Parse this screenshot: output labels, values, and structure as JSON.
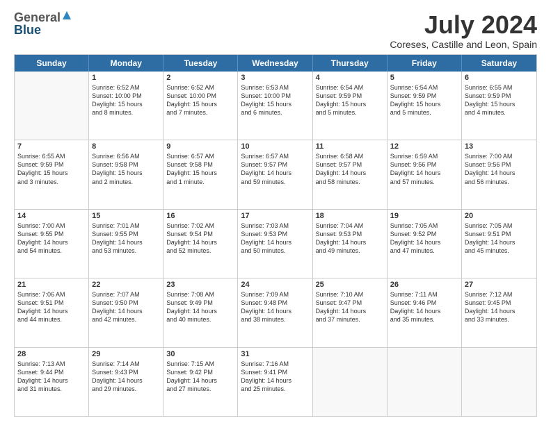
{
  "logo": {
    "general": "General",
    "blue": "Blue"
  },
  "title": "July 2024",
  "subtitle": "Coreses, Castille and Leon, Spain",
  "days": [
    "Sunday",
    "Monday",
    "Tuesday",
    "Wednesday",
    "Thursday",
    "Friday",
    "Saturday"
  ],
  "weeks": [
    [
      {
        "day": "",
        "lines": []
      },
      {
        "day": "1",
        "lines": [
          "Sunrise: 6:52 AM",
          "Sunset: 10:00 PM",
          "Daylight: 15 hours",
          "and 8 minutes."
        ]
      },
      {
        "day": "2",
        "lines": [
          "Sunrise: 6:52 AM",
          "Sunset: 10:00 PM",
          "Daylight: 15 hours",
          "and 7 minutes."
        ]
      },
      {
        "day": "3",
        "lines": [
          "Sunrise: 6:53 AM",
          "Sunset: 10:00 PM",
          "Daylight: 15 hours",
          "and 6 minutes."
        ]
      },
      {
        "day": "4",
        "lines": [
          "Sunrise: 6:54 AM",
          "Sunset: 9:59 PM",
          "Daylight: 15 hours",
          "and 5 minutes."
        ]
      },
      {
        "day": "5",
        "lines": [
          "Sunrise: 6:54 AM",
          "Sunset: 9:59 PM",
          "Daylight: 15 hours",
          "and 5 minutes."
        ]
      },
      {
        "day": "6",
        "lines": [
          "Sunrise: 6:55 AM",
          "Sunset: 9:59 PM",
          "Daylight: 15 hours",
          "and 4 minutes."
        ]
      }
    ],
    [
      {
        "day": "7",
        "lines": [
          "Sunrise: 6:55 AM",
          "Sunset: 9:59 PM",
          "Daylight: 15 hours",
          "and 3 minutes."
        ]
      },
      {
        "day": "8",
        "lines": [
          "Sunrise: 6:56 AM",
          "Sunset: 9:58 PM",
          "Daylight: 15 hours",
          "and 2 minutes."
        ]
      },
      {
        "day": "9",
        "lines": [
          "Sunrise: 6:57 AM",
          "Sunset: 9:58 PM",
          "Daylight: 15 hours",
          "and 1 minute."
        ]
      },
      {
        "day": "10",
        "lines": [
          "Sunrise: 6:57 AM",
          "Sunset: 9:57 PM",
          "Daylight: 14 hours",
          "and 59 minutes."
        ]
      },
      {
        "day": "11",
        "lines": [
          "Sunrise: 6:58 AM",
          "Sunset: 9:57 PM",
          "Daylight: 14 hours",
          "and 58 minutes."
        ]
      },
      {
        "day": "12",
        "lines": [
          "Sunrise: 6:59 AM",
          "Sunset: 9:56 PM",
          "Daylight: 14 hours",
          "and 57 minutes."
        ]
      },
      {
        "day": "13",
        "lines": [
          "Sunrise: 7:00 AM",
          "Sunset: 9:56 PM",
          "Daylight: 14 hours",
          "and 56 minutes."
        ]
      }
    ],
    [
      {
        "day": "14",
        "lines": [
          "Sunrise: 7:00 AM",
          "Sunset: 9:55 PM",
          "Daylight: 14 hours",
          "and 54 minutes."
        ]
      },
      {
        "day": "15",
        "lines": [
          "Sunrise: 7:01 AM",
          "Sunset: 9:55 PM",
          "Daylight: 14 hours",
          "and 53 minutes."
        ]
      },
      {
        "day": "16",
        "lines": [
          "Sunrise: 7:02 AM",
          "Sunset: 9:54 PM",
          "Daylight: 14 hours",
          "and 52 minutes."
        ]
      },
      {
        "day": "17",
        "lines": [
          "Sunrise: 7:03 AM",
          "Sunset: 9:53 PM",
          "Daylight: 14 hours",
          "and 50 minutes."
        ]
      },
      {
        "day": "18",
        "lines": [
          "Sunrise: 7:04 AM",
          "Sunset: 9:53 PM",
          "Daylight: 14 hours",
          "and 49 minutes."
        ]
      },
      {
        "day": "19",
        "lines": [
          "Sunrise: 7:05 AM",
          "Sunset: 9:52 PM",
          "Daylight: 14 hours",
          "and 47 minutes."
        ]
      },
      {
        "day": "20",
        "lines": [
          "Sunrise: 7:05 AM",
          "Sunset: 9:51 PM",
          "Daylight: 14 hours",
          "and 45 minutes."
        ]
      }
    ],
    [
      {
        "day": "21",
        "lines": [
          "Sunrise: 7:06 AM",
          "Sunset: 9:51 PM",
          "Daylight: 14 hours",
          "and 44 minutes."
        ]
      },
      {
        "day": "22",
        "lines": [
          "Sunrise: 7:07 AM",
          "Sunset: 9:50 PM",
          "Daylight: 14 hours",
          "and 42 minutes."
        ]
      },
      {
        "day": "23",
        "lines": [
          "Sunrise: 7:08 AM",
          "Sunset: 9:49 PM",
          "Daylight: 14 hours",
          "and 40 minutes."
        ]
      },
      {
        "day": "24",
        "lines": [
          "Sunrise: 7:09 AM",
          "Sunset: 9:48 PM",
          "Daylight: 14 hours",
          "and 38 minutes."
        ]
      },
      {
        "day": "25",
        "lines": [
          "Sunrise: 7:10 AM",
          "Sunset: 9:47 PM",
          "Daylight: 14 hours",
          "and 37 minutes."
        ]
      },
      {
        "day": "26",
        "lines": [
          "Sunrise: 7:11 AM",
          "Sunset: 9:46 PM",
          "Daylight: 14 hours",
          "and 35 minutes."
        ]
      },
      {
        "day": "27",
        "lines": [
          "Sunrise: 7:12 AM",
          "Sunset: 9:45 PM",
          "Daylight: 14 hours",
          "and 33 minutes."
        ]
      }
    ],
    [
      {
        "day": "28",
        "lines": [
          "Sunrise: 7:13 AM",
          "Sunset: 9:44 PM",
          "Daylight: 14 hours",
          "and 31 minutes."
        ]
      },
      {
        "day": "29",
        "lines": [
          "Sunrise: 7:14 AM",
          "Sunset: 9:43 PM",
          "Daylight: 14 hours",
          "and 29 minutes."
        ]
      },
      {
        "day": "30",
        "lines": [
          "Sunrise: 7:15 AM",
          "Sunset: 9:42 PM",
          "Daylight: 14 hours",
          "and 27 minutes."
        ]
      },
      {
        "day": "31",
        "lines": [
          "Sunrise: 7:16 AM",
          "Sunset: 9:41 PM",
          "Daylight: 14 hours",
          "and 25 minutes."
        ]
      },
      {
        "day": "",
        "lines": []
      },
      {
        "day": "",
        "lines": []
      },
      {
        "day": "",
        "lines": []
      }
    ]
  ]
}
